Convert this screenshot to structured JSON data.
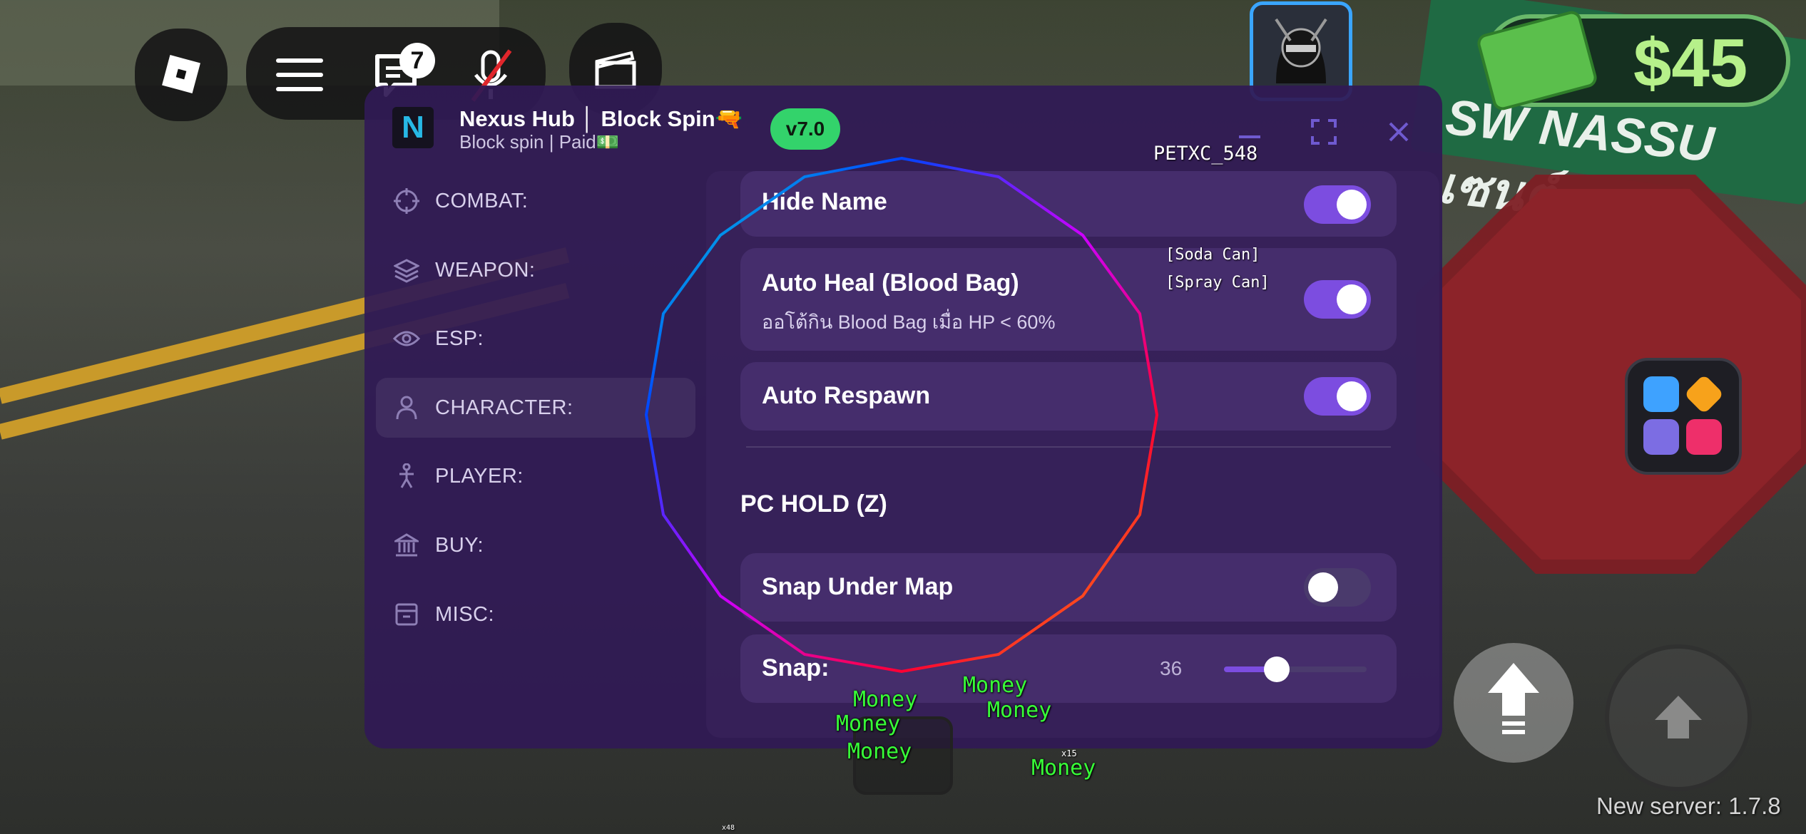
{
  "topbar": {
    "chat_badge": "7"
  },
  "money": "$45",
  "street_sign": "SW NASSU เซนต์",
  "window": {
    "title": "Nexus Hub │ Block Spin🔫",
    "subtitle": "Block spin | Paid💵",
    "version": "v7.0",
    "minimize_icon": "minimize-icon",
    "maximize_icon": "maximize-icon",
    "close_icon": "close-icon"
  },
  "sidebar": {
    "items": [
      {
        "label": "COMBAT:",
        "icon": "crosshair-icon"
      },
      {
        "label": "WEAPON:",
        "icon": "layers-icon"
      },
      {
        "label": "ESP:",
        "icon": "eye-icon"
      },
      {
        "label": "CHARACTER:",
        "icon": "person-icon"
      },
      {
        "label": "PLAYER:",
        "icon": "running-person-icon"
      },
      {
        "label": "BUY:",
        "icon": "bank-icon"
      },
      {
        "label": "MISC:",
        "icon": "archive-icon"
      }
    ],
    "selected": "CHARACTER:"
  },
  "settings": {
    "hide_name": {
      "label": "Hide Name",
      "on": true
    },
    "auto_heal": {
      "label": "Auto Heal (Blood Bag)",
      "desc": "ออโต้กิน Blood Bag เมื่อ HP < 60%",
      "on": true
    },
    "auto_respawn": {
      "label": "Auto Respawn",
      "on": true
    },
    "section_title": "PC HOLD (Z)",
    "snap_under_map": {
      "label": "Snap Under Map",
      "on": false
    },
    "snap": {
      "label": "Snap:",
      "value": "36"
    }
  },
  "esp": {
    "player_name": "PETXC_548",
    "item_1": "[Soda Can]",
    "item_2": "[Spray Can]",
    "money_labels": [
      "Money",
      "Money",
      "Money",
      "Money",
      "Money",
      "Money"
    ],
    "fov_circle_colors": [
      "#ff0000",
      "#ff8800",
      "#ffff00",
      "#00ff00",
      "#00ffff",
      "#0000ff",
      "#aa00ff",
      "#ff00aa"
    ]
  },
  "hotbar": {
    "small_label_1": "x15",
    "small_label_2": "x48"
  },
  "server_version": "New server: 1.7.8"
}
